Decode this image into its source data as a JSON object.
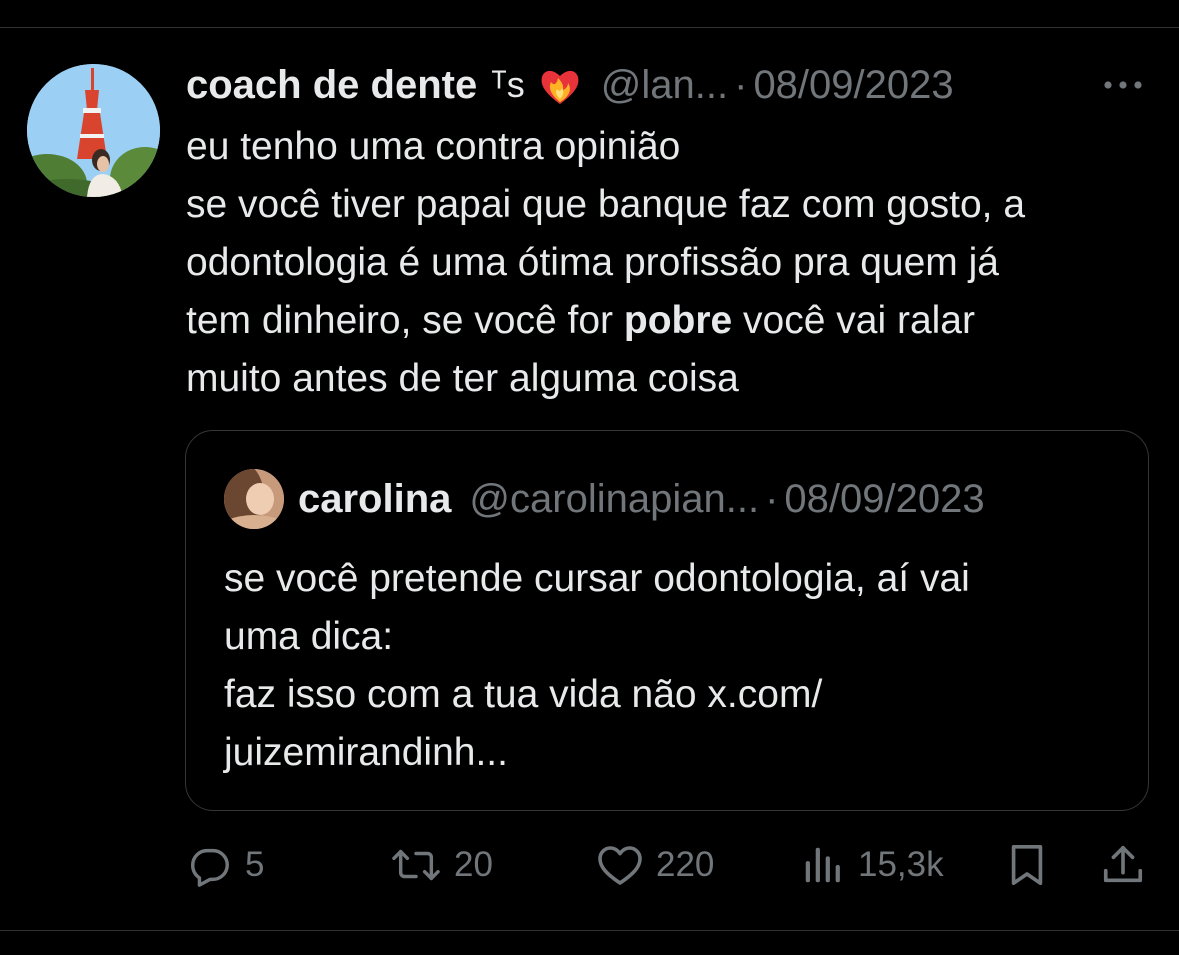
{
  "tweet": {
    "display_name": "coach de dente",
    "name_suffix": "ᵀs",
    "badge_emoji_icon": "heart-on-fire-icon",
    "handle": "@lan...",
    "separator": "·",
    "date": "08/09/2023",
    "text": {
      "line1": "eu tenho uma contra opinião",
      "line2": "se você tiver papai que banque faz com gosto, a",
      "line3": "odontologia é uma ótima profissão pra quem já",
      "line4a": "tem dinheiro, se você for ",
      "line4b": "pobre",
      "line4c": " você vai ralar",
      "line5": "muito antes de ter alguma coisa"
    }
  },
  "quote": {
    "display_name": "carolina",
    "handle": "@carolinapian...",
    "separator": "·",
    "date": "08/09/2023",
    "text": {
      "line1": "se você pretende cursar odontologia, aí vai",
      "line2": "uma dica:",
      "line3": "faz isso com a tua vida não x.com/",
      "line4": "juizemirandinh..."
    }
  },
  "actions": {
    "replies": "5",
    "reposts": "20",
    "likes": "220",
    "views": "15,3k"
  },
  "colors": {
    "background": "#000000",
    "text": "#e7e9ea",
    "muted": "#71767b",
    "border": "#2f3336"
  }
}
